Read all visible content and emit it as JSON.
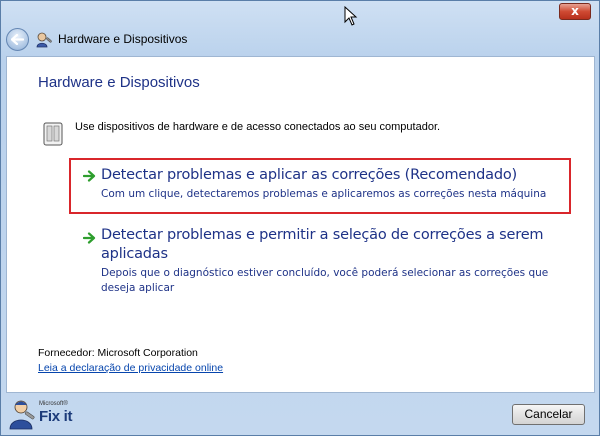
{
  "window": {
    "title": "Hardware e Dispositivos",
    "close_glyph": "x"
  },
  "content": {
    "heading": "Hardware e Dispositivos",
    "description": "Use dispositivos de hardware e de acesso conectados ao seu computador.",
    "options": [
      {
        "title": "Detectar problemas e aplicar as correções (Recomendado)",
        "description": "Com um clique, detectaremos problemas e aplicaremos as correções nesta máquina",
        "highlighted": true
      },
      {
        "title": "Detectar problemas e permitir a seleção de correções a serem aplicadas",
        "description": "Depois que o diagnóstico estiver concluído, você poderá selecionar as correções que deseja aplicar",
        "highlighted": false
      }
    ],
    "vendor": "Fornecedor: Microsoft Corporation",
    "privacy_link": "Leia a declaração de privacidade online"
  },
  "footer": {
    "logo_brand": "Microsoft®",
    "logo_name": "Fix it",
    "cancel_label": "Cancelar"
  },
  "colors": {
    "accent_text": "#1e3287",
    "highlight_border": "#d9262b",
    "arrow_green": "#2e9e2e",
    "link": "#0645ad"
  },
  "icons": {
    "back": "back-arrow-icon",
    "title": "troubleshooter-icon",
    "device": "device-icon",
    "option": "green-arrow-icon",
    "close": "close-icon"
  }
}
